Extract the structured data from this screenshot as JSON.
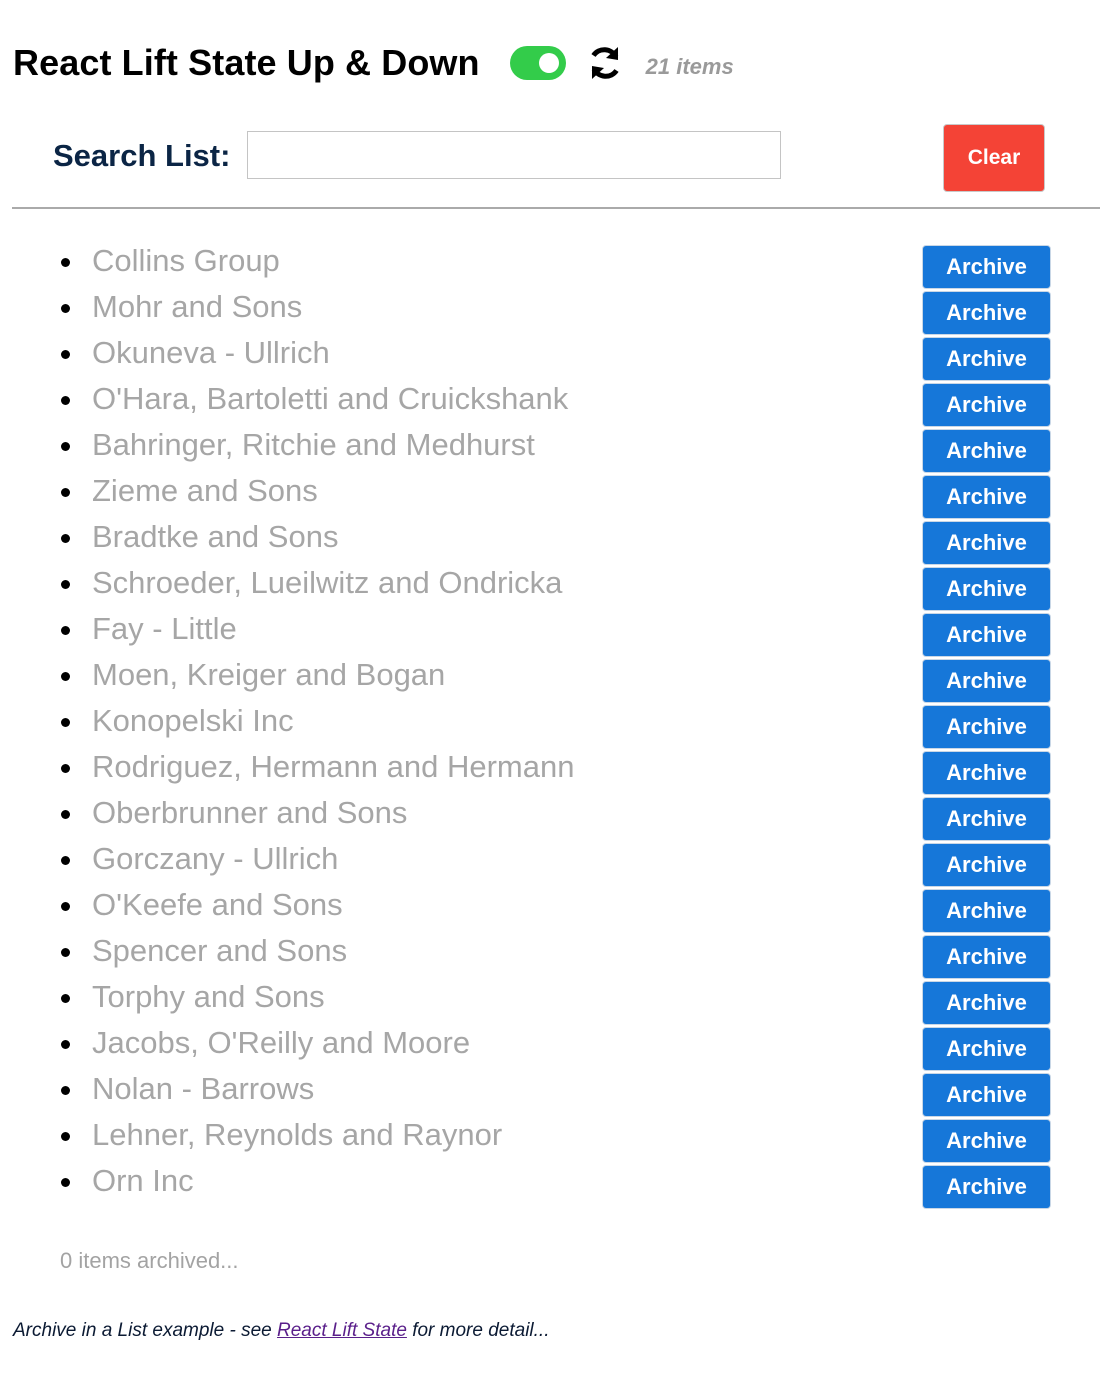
{
  "header": {
    "title": "React Lift State Up & Down",
    "toggle_on": true,
    "count_label": "21 items"
  },
  "search": {
    "label": "Search List:",
    "value": "",
    "placeholder": "",
    "clear_label": "Clear"
  },
  "list": {
    "items": [
      {
        "name": "Collins Group",
        "button": "Archive"
      },
      {
        "name": "Mohr and Sons",
        "button": "Archive"
      },
      {
        "name": "Okuneva - Ullrich",
        "button": "Archive"
      },
      {
        "name": "O'Hara, Bartoletti and Cruickshank",
        "button": "Archive"
      },
      {
        "name": "Bahringer, Ritchie and Medhurst",
        "button": "Archive"
      },
      {
        "name": "Zieme and Sons",
        "button": "Archive"
      },
      {
        "name": "Bradtke and Sons",
        "button": "Archive"
      },
      {
        "name": "Schroeder, Lueilwitz and Ondricka",
        "button": "Archive"
      },
      {
        "name": "Fay - Little",
        "button": "Archive"
      },
      {
        "name": "Moen, Kreiger and Bogan",
        "button": "Archive"
      },
      {
        "name": "Konopelski Inc",
        "button": "Archive"
      },
      {
        "name": "Rodriguez, Hermann and Hermann",
        "button": "Archive"
      },
      {
        "name": "Oberbrunner and Sons",
        "button": "Archive"
      },
      {
        "name": "Gorczany - Ullrich",
        "button": "Archive"
      },
      {
        "name": "O'Keefe and Sons",
        "button": "Archive"
      },
      {
        "name": "Spencer and Sons",
        "button": "Archive"
      },
      {
        "name": "Torphy and Sons",
        "button": "Archive"
      },
      {
        "name": "Jacobs, O'Reilly and Moore",
        "button": "Archive"
      },
      {
        "name": "Nolan - Barrows",
        "button": "Archive"
      },
      {
        "name": "Lehner, Reynolds and Raynor",
        "button": "Archive"
      },
      {
        "name": "Orn Inc",
        "button": "Archive"
      }
    ]
  },
  "archived_status": "0 items archived...",
  "footer": {
    "prefix": "Archive in a List example - see ",
    "link_text": "React Lift State",
    "suffix": " for more detail..."
  },
  "colors": {
    "toggle": "#33cc4a",
    "clear_button": "#f44336",
    "archive_button": "#1677d9",
    "item_text": "#a6a6a6",
    "label_text": "#0b2545"
  },
  "icons": {
    "refresh": "refresh-icon",
    "toggle": "toggle-switch"
  }
}
